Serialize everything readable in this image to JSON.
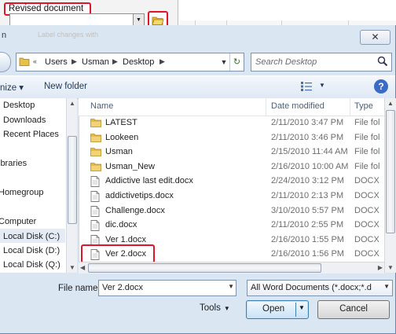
{
  "background_window": {
    "revised_label": "Revised document",
    "faded_text": "Label changes with"
  },
  "dialog": {
    "title_fragment": "n",
    "close_label": "✕"
  },
  "address": {
    "crumbs": [
      "Users",
      "Usman",
      "Desktop"
    ],
    "search_placeholder": "Search Desktop"
  },
  "toolbar": {
    "organize_label": "nize ▾",
    "new_folder_label": "New folder",
    "help_label": "?"
  },
  "nav": {
    "items": [
      {
        "label": "Desktop"
      },
      {
        "label": "Downloads"
      },
      {
        "label": "Recent Places"
      },
      {
        "label": "ibraries"
      },
      {
        "label": "Homegroup"
      },
      {
        "label": "Computer"
      },
      {
        "label": "Local Disk (C:)"
      },
      {
        "label": "Local Disk (D:)"
      },
      {
        "label": "Local Disk (Q:)"
      }
    ]
  },
  "columns": {
    "name": "Name",
    "date": "Date modified",
    "type": "Type"
  },
  "files": [
    {
      "name": "LATEST",
      "date": "2/11/2010 3:47 PM",
      "type": "File fol",
      "icon": "folder-icon"
    },
    {
      "name": "Lookeen",
      "date": "2/11/2010 3:46 PM",
      "type": "File fol",
      "icon": "folder-icon"
    },
    {
      "name": "Usman",
      "date": "2/15/2010 11:44 AM",
      "type": "File fol",
      "icon": "folder-icon"
    },
    {
      "name": "Usman_New",
      "date": "2/16/2010 10:00 AM",
      "type": "File fol",
      "icon": "folder-icon"
    },
    {
      "name": "Addictive last edit.docx",
      "date": "2/24/2010 3:12 PM",
      "type": "DOCX",
      "icon": "document-icon"
    },
    {
      "name": "addictivetips.docx",
      "date": "2/11/2010 2:13 PM",
      "type": "DOCX",
      "icon": "document-icon"
    },
    {
      "name": "Challenge.docx",
      "date": "3/10/2010 5:57 PM",
      "type": "DOCX",
      "icon": "document-icon"
    },
    {
      "name": "dic.docx",
      "date": "2/11/2010 2:55 PM",
      "type": "DOCX",
      "icon": "document-icon"
    },
    {
      "name": "Ver 1.docx",
      "date": "2/16/2010 1:55 PM",
      "type": "DOCX",
      "icon": "document-icon"
    },
    {
      "name": "Ver 2.docx",
      "date": "2/16/2010 1:56 PM",
      "type": "DOCX",
      "icon": "document-icon"
    }
  ],
  "bottom": {
    "file_name_label": "File name:",
    "file_name_value": "Ver 2.docx",
    "filter_value": "All Word Documents (*.docx;*.d",
    "tools_label": "Tools",
    "open_label": "Open",
    "cancel_label": "Cancel"
  },
  "colors": {
    "highlight_border": "#e0152b",
    "folder": "#e8c04a"
  }
}
